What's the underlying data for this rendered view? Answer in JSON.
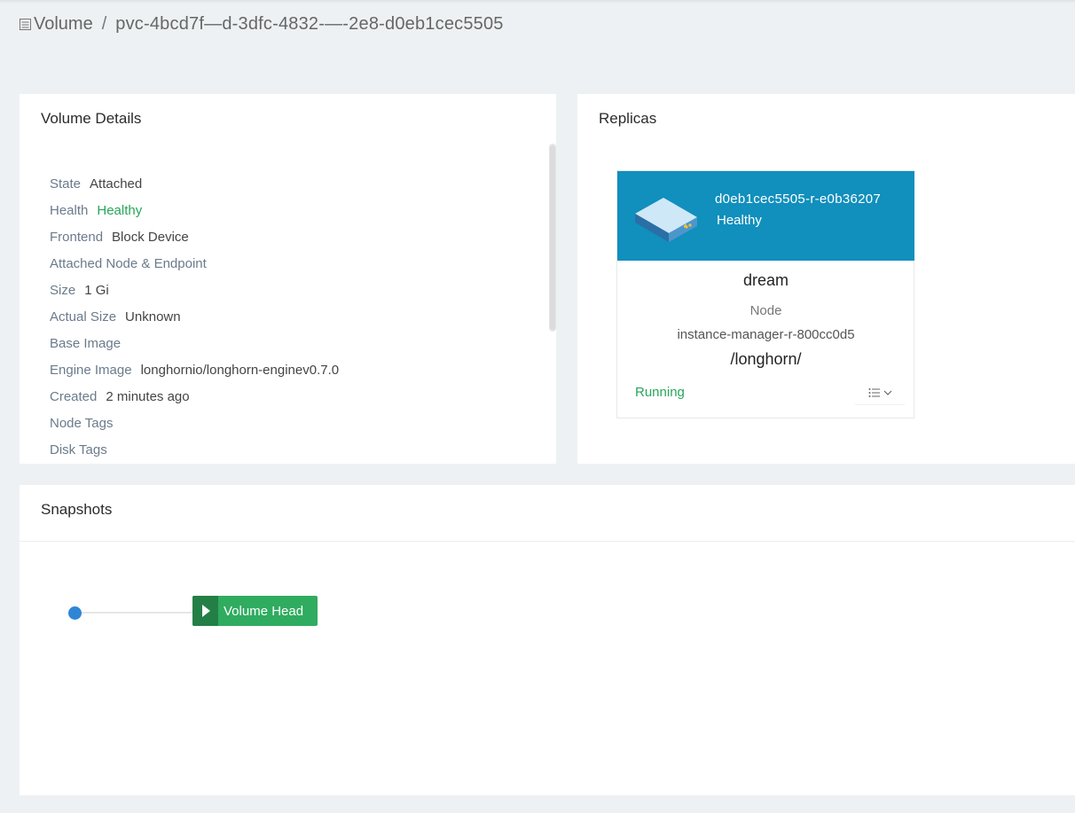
{
  "breadcrumb": {
    "section": "Volume",
    "separator": "/",
    "volume_name": "pvc-4bcd7f—d-3dfc-4832-—-2e8-d0eb1cec5505"
  },
  "details": {
    "title": "Volume Details",
    "rows": [
      {
        "key": "State",
        "value": "Attached"
      },
      {
        "key": "Health",
        "value": "Healthy"
      },
      {
        "key": "Frontend",
        "value": "Block Device"
      },
      {
        "key": "Attached Node & Endpoint",
        "value": ""
      },
      {
        "key": "Size",
        "value": "1 Gi"
      },
      {
        "key": "Actual Size",
        "value": "Unknown"
      },
      {
        "key": "Base Image",
        "value": ""
      },
      {
        "key": "Engine Image",
        "value": "longhornio/longhorn-enginev0.7.0"
      },
      {
        "key": "Created",
        "value": "2 minutes ago"
      },
      {
        "key": "Node Tags",
        "value": ""
      },
      {
        "key": "Disk Tags",
        "value": ""
      }
    ]
  },
  "replicas": {
    "title": "Replicas",
    "items": [
      {
        "name": "d0eb1cec5505-r-e0b36207",
        "health": "Healthy",
        "node": "dream",
        "node_label": "Node",
        "instance_manager": "instance-manager-r-800cc0d5",
        "path": "/longhorn/",
        "status": "Running"
      }
    ]
  },
  "snapshots": {
    "title": "Snapshots",
    "head_label": "Volume Head"
  },
  "colors": {
    "page_bg": "#eef1f3",
    "replica_header": "#118fbd",
    "healthy_green": "#27a55b",
    "volume_head_green": "#2fac5f",
    "snapshot_dot_blue": "#2f86d6"
  }
}
